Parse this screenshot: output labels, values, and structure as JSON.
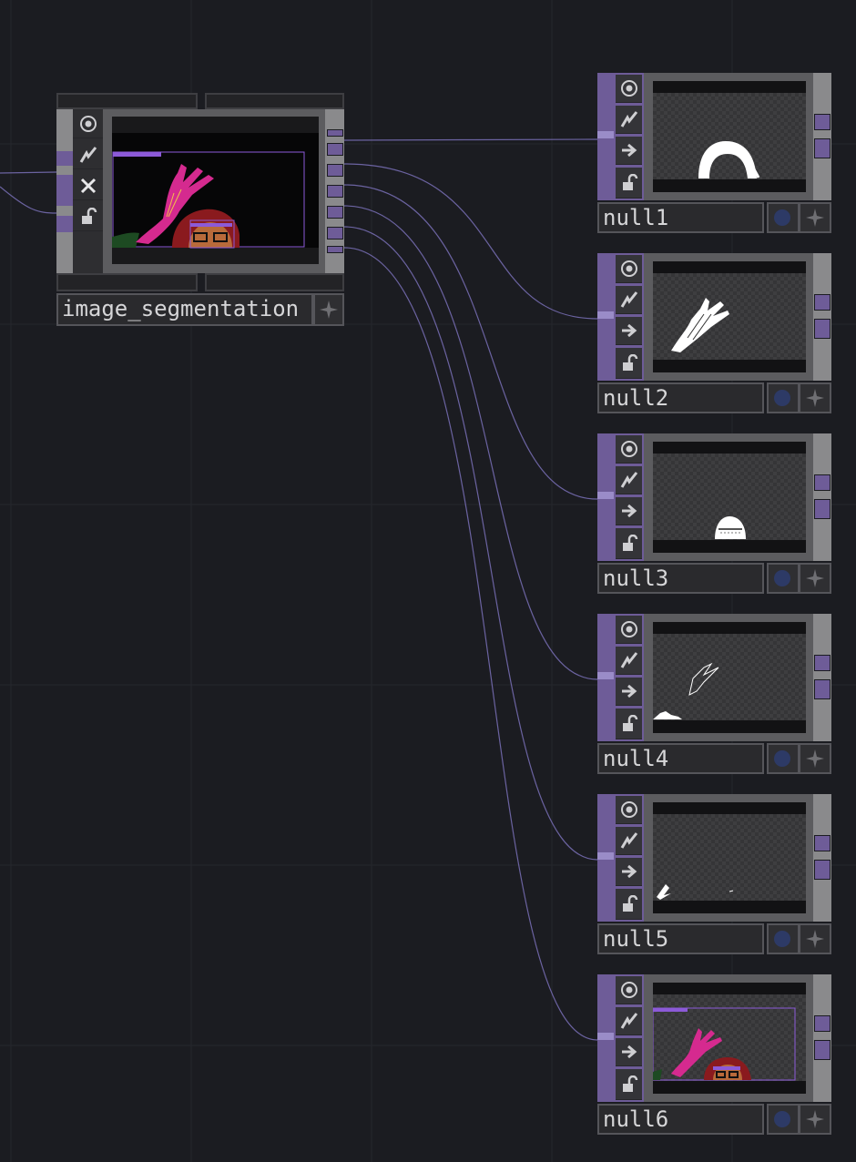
{
  "network": {
    "source_node": {
      "name": "image_segmentation",
      "icons": [
        "viewer-icon",
        "cook-icon",
        "bypass-icon",
        "lock-icon"
      ]
    },
    "null_nodes": [
      {
        "name": "null1",
        "preview": "hair-mask"
      },
      {
        "name": "null2",
        "preview": "hand-mask"
      },
      {
        "name": "null3",
        "preview": "face-mask"
      },
      {
        "name": "null4",
        "preview": "outline-mask"
      },
      {
        "name": "null5",
        "preview": "shard-mask"
      },
      {
        "name": "null6",
        "preview": "composite"
      }
    ],
    "null_icons": [
      "viewer-icon",
      "cook-icon",
      "export-icon",
      "lock-icon"
    ]
  },
  "colors": {
    "background": "#1b1c21",
    "wire": "#7a70b8",
    "port": "#6e5c98",
    "magenta": "#d52a8f",
    "hair": "#8a1a1e"
  }
}
